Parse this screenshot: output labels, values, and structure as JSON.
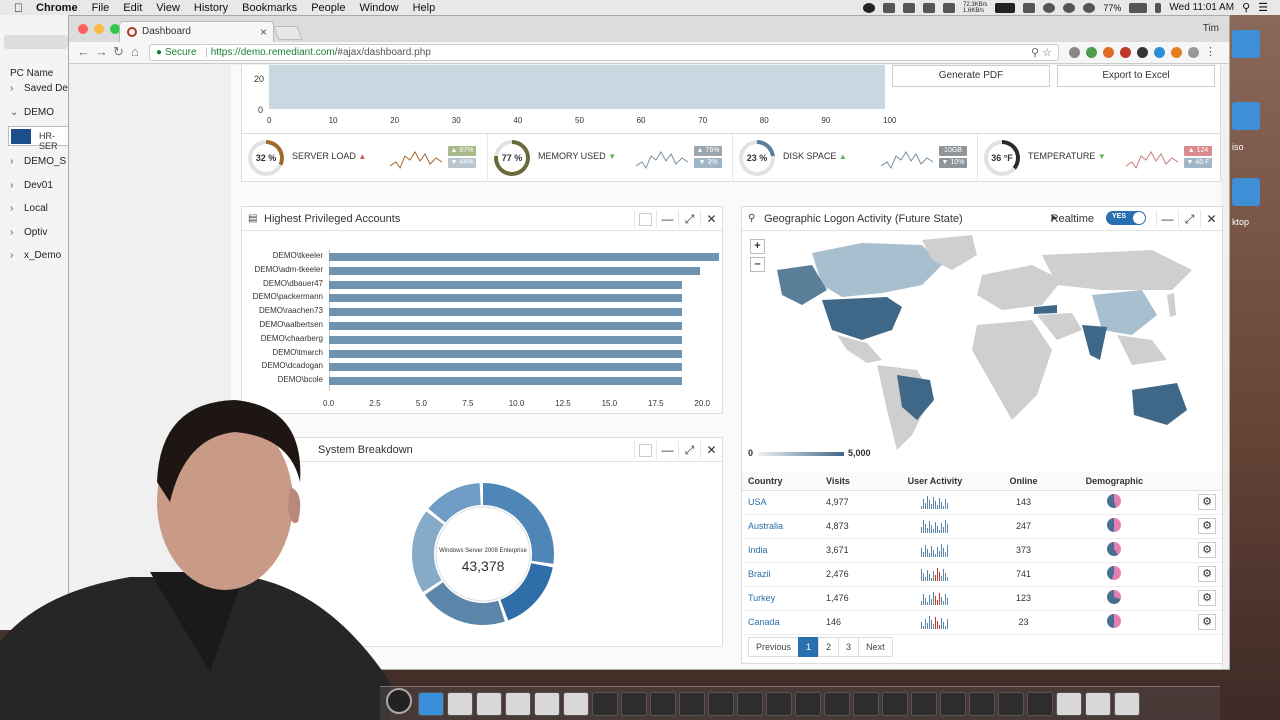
{
  "menubar": {
    "app": "Chrome",
    "items": [
      "File",
      "Edit",
      "View",
      "History",
      "Bookmarks",
      "People",
      "Window",
      "Help"
    ],
    "net_up": "72.3KB/s",
    "net_down": "1.6KB/s",
    "battery": "77%",
    "clock": "Wed 11:01 AM"
  },
  "side_app": {
    "column_header": "PC Name",
    "items": [
      {
        "label": "Saved De",
        "expanded": false
      },
      {
        "label": "DEMO",
        "expanded": true
      },
      {
        "label": "HR-SER",
        "selected": true
      },
      {
        "label": "DEMO_S",
        "expanded": false
      },
      {
        "label": "Dev01",
        "expanded": false
      },
      {
        "label": "Local",
        "expanded": false
      },
      {
        "label": "Optiv",
        "expanded": false
      },
      {
        "label": "x_Demo",
        "expanded": false
      }
    ]
  },
  "desktop_labels": [
    "iso",
    "ktop"
  ],
  "browser": {
    "tab_title": "Dashboard",
    "user": "Tim",
    "secure_label": "Secure",
    "url_scheme": "https://",
    "url_host": "demo.remediant.com",
    "url_path": "/#ajax/dashboard.php"
  },
  "top_chart": {
    "y_ticks": [
      "20",
      "0"
    ],
    "x_ticks": [
      "0",
      "10",
      "20",
      "30",
      "40",
      "50",
      "60",
      "70",
      "80",
      "90",
      "100"
    ],
    "buttons": {
      "pdf": "Generate PDF",
      "excel": "Export to Excel"
    }
  },
  "metrics": [
    {
      "name": "SERVER LOAD",
      "value": "32 %",
      "percent": 32,
      "trend": "up",
      "trend_color": "#d9534f",
      "badge_top": "▲ 97%",
      "badge_bottom": "▼ 44%",
      "ring_color": "#a06a2c",
      "badge_top_color": "#a8b98a",
      "badge_bottom_color": "#b9c5cf",
      "spark_color": "#a06a2c"
    },
    {
      "name": "MEMORY USED",
      "value": "77 %",
      "percent": 77,
      "trend": "down",
      "trend_color": "#5cb85c",
      "badge_top": "▲ 76%",
      "badge_bottom": "▼ 3%",
      "ring_color": "#6b6b3a",
      "badge_top_color": "#9aa5ad",
      "badge_bottom_color": "#9fb6c6",
      "spark_color": "#7a8fa0"
    },
    {
      "name": "DISK SPACE",
      "value": "23 %",
      "percent": 23,
      "trend": "up",
      "trend_color": "#5cb85c",
      "badge_top": "10GB",
      "badge_bottom": "▼ 10%",
      "ring_color": "#5a7d99",
      "badge_top_color": "#8e969c",
      "badge_bottom_color": "#8e969c",
      "spark_color": "#7a8fa0"
    },
    {
      "name": "TEMPERATURE",
      "value": "36 °F",
      "percent": 36,
      "trend": "down",
      "trend_color": "#5cb85c",
      "badge_top": "▲ 124",
      "badge_bottom": "▼ 40 F",
      "ring_color": "#2b2b2b",
      "badge_top_color": "#d98a8a",
      "badge_bottom_color": "#9fb6c6",
      "spark_color": "#c77b7b"
    }
  ],
  "privileged": {
    "title": "Highest Privileged Accounts",
    "chart_data": {
      "type": "bar",
      "orientation": "horizontal",
      "categories": [
        "DEMO\\tkeeler",
        "DEMO\\adm-tkeeler",
        "DEMO\\dbauer47",
        "DEMO\\packermann",
        "DEMO\\raachen73",
        "DEMO\\aalbertsen",
        "DEMO\\chaarberg",
        "DEMO\\tmarch",
        "DEMO\\dcadogan",
        "DEMO\\bcole"
      ],
      "values": [
        21,
        20,
        19,
        19,
        19,
        19,
        19,
        19,
        19,
        19
      ],
      "x_ticks": [
        "0.0",
        "2.5",
        "5.0",
        "7.5",
        "10.0",
        "12.5",
        "15.0",
        "17.5",
        "20.0"
      ],
      "xlim": [
        0,
        21
      ],
      "color": "#6f94b2"
    }
  },
  "system": {
    "title": "System Breakdown",
    "center_label": "Windows Server 2008 Enterprise",
    "center_value": "43,378",
    "segments": [
      {
        "value": 28,
        "color": "#4f86b8"
      },
      {
        "value": 17,
        "color": "#2f6ea8"
      },
      {
        "value": 21,
        "color": "#5b86a9"
      },
      {
        "value": 20,
        "color": "#86abc9"
      },
      {
        "value": 14,
        "color": "#6f9dc7"
      }
    ]
  },
  "geo": {
    "title": "Geographic Logon Activity (Future State)",
    "realtime_label": "Realtime",
    "toggle_label": "YES",
    "legend_min": "0",
    "legend_max": "5,000",
    "columns": [
      "Country",
      "Visits",
      "User Activity",
      "Online",
      "Demographic"
    ],
    "rows": [
      {
        "country": "USA",
        "visits": "4,977",
        "online": "143",
        "pie": 0.45
      },
      {
        "country": "Australia",
        "visits": "4,873",
        "online": "247",
        "pie": 0.5
      },
      {
        "country": "India",
        "visits": "3,671",
        "online": "373",
        "pie": 0.4
      },
      {
        "country": "Brazil",
        "visits": "2,476",
        "online": "741",
        "pie": 0.55
      },
      {
        "country": "Turkey",
        "visits": "1,476",
        "online": "123",
        "pie": 0.3
      },
      {
        "country": "Canada",
        "visits": "146",
        "online": "23",
        "pie": 0.5
      }
    ],
    "pager": {
      "prev": "Previous",
      "pages": [
        "1",
        "2",
        "3"
      ],
      "next": "Next",
      "active": "1"
    }
  }
}
